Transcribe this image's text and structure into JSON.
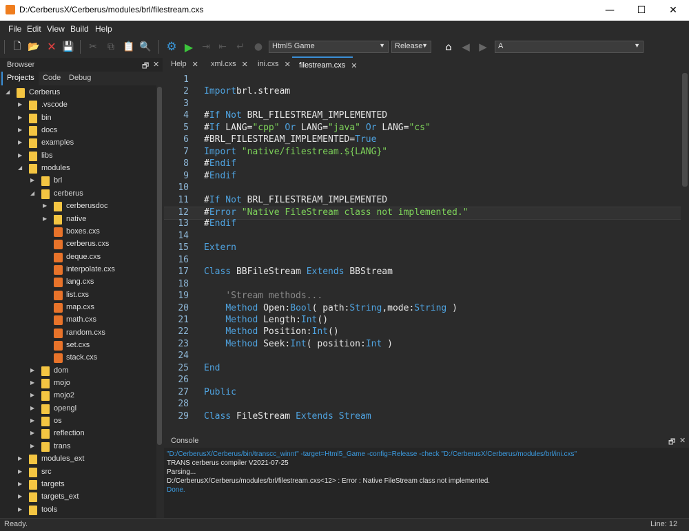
{
  "window": {
    "title": "D:/CerberusX/Cerberus/modules/brl/filestream.cxs",
    "min": "—",
    "max": "☐",
    "close": "✕"
  },
  "menu": [
    "File",
    "Edit",
    "View",
    "Build",
    "Help"
  ],
  "toolbar": {
    "target": "Html5 Game",
    "config": "Release",
    "search": "A"
  },
  "browser": {
    "title": "Browser",
    "pin": "🗗",
    "close": "✕",
    "tabs": [
      "Projects",
      "Code",
      "Debug"
    ]
  },
  "tree": [
    {
      "label": "Cerberus",
      "level": 0,
      "type": "folder",
      "expanded": true
    },
    {
      "label": ".vscode",
      "level": 1,
      "type": "folder",
      "expanded": false
    },
    {
      "label": "bin",
      "level": 1,
      "type": "folder",
      "expanded": false
    },
    {
      "label": "docs",
      "level": 1,
      "type": "folder",
      "expanded": false
    },
    {
      "label": "examples",
      "level": 1,
      "type": "folder",
      "expanded": false
    },
    {
      "label": "libs",
      "level": 1,
      "type": "folder",
      "expanded": false
    },
    {
      "label": "modules",
      "level": 1,
      "type": "folder",
      "expanded": true
    },
    {
      "label": "brl",
      "level": 2,
      "type": "folder",
      "expanded": false
    },
    {
      "label": "cerberus",
      "level": 2,
      "type": "folder",
      "expanded": true
    },
    {
      "label": "cerberusdoc",
      "level": 3,
      "type": "folder",
      "expanded": false
    },
    {
      "label": "native",
      "level": 3,
      "type": "folder",
      "expanded": false
    },
    {
      "label": "boxes.cxs",
      "level": 3,
      "type": "file"
    },
    {
      "label": "cerberus.cxs",
      "level": 3,
      "type": "file"
    },
    {
      "label": "deque.cxs",
      "level": 3,
      "type": "file"
    },
    {
      "label": "interpolate.cxs",
      "level": 3,
      "type": "file"
    },
    {
      "label": "lang.cxs",
      "level": 3,
      "type": "file"
    },
    {
      "label": "list.cxs",
      "level": 3,
      "type": "file"
    },
    {
      "label": "map.cxs",
      "level": 3,
      "type": "file"
    },
    {
      "label": "math.cxs",
      "level": 3,
      "type": "file"
    },
    {
      "label": "random.cxs",
      "level": 3,
      "type": "file"
    },
    {
      "label": "set.cxs",
      "level": 3,
      "type": "file"
    },
    {
      "label": "stack.cxs",
      "level": 3,
      "type": "file"
    },
    {
      "label": "dom",
      "level": 2,
      "type": "folder",
      "expanded": false
    },
    {
      "label": "mojo",
      "level": 2,
      "type": "folder",
      "expanded": false
    },
    {
      "label": "mojo2",
      "level": 2,
      "type": "folder",
      "expanded": false
    },
    {
      "label": "opengl",
      "level": 2,
      "type": "folder",
      "expanded": false
    },
    {
      "label": "os",
      "level": 2,
      "type": "folder",
      "expanded": false
    },
    {
      "label": "reflection",
      "level": 2,
      "type": "folder",
      "expanded": false
    },
    {
      "label": "trans",
      "level": 2,
      "type": "folder",
      "expanded": false
    },
    {
      "label": "modules_ext",
      "level": 1,
      "type": "folder",
      "expanded": false
    },
    {
      "label": "src",
      "level": 1,
      "type": "folder",
      "expanded": false
    },
    {
      "label": "targets",
      "level": 1,
      "type": "folder",
      "expanded": false
    },
    {
      "label": "targets_ext",
      "level": 1,
      "type": "folder",
      "expanded": false
    },
    {
      "label": "tools",
      "level": 1,
      "type": "folder",
      "expanded": false
    }
  ],
  "editor_tabs": [
    {
      "label": "Help",
      "active": false
    },
    {
      "label": "xml.cxs",
      "active": false
    },
    {
      "label": "ini.cxs",
      "active": false
    },
    {
      "label": "filestream.cxs",
      "active": true
    }
  ],
  "code": [
    {
      "n": "1",
      "t": []
    },
    {
      "n": "2",
      "t": [
        [
          "kw",
          "Import"
        ],
        [
          "",
          "brl.stream"
        ]
      ]
    },
    {
      "n": "3",
      "t": []
    },
    {
      "n": "4",
      "t": [
        [
          "",
          "#"
        ],
        [
          "kw",
          "If Not"
        ],
        [
          "",
          " BRL_FILESTREAM_IMPLEMENTED"
        ]
      ]
    },
    {
      "n": "5",
      "t": [
        [
          "",
          "#"
        ],
        [
          "kw",
          "If"
        ],
        [
          "",
          " LANG="
        ],
        [
          "st",
          "\"cpp\""
        ],
        [
          "",
          " "
        ],
        [
          "kw",
          "Or"
        ],
        [
          "",
          " LANG="
        ],
        [
          "st",
          "\"java\""
        ],
        [
          "",
          " "
        ],
        [
          "kw",
          "Or"
        ],
        [
          "",
          " LANG="
        ],
        [
          "st",
          "\"cs\""
        ]
      ]
    },
    {
      "n": "6",
      "t": [
        [
          "",
          "#BRL_FILESTREAM_IMPLEMENTED="
        ],
        [
          "kw",
          "True"
        ]
      ]
    },
    {
      "n": "7",
      "t": [
        [
          "kw",
          "Import"
        ],
        [
          "",
          " "
        ],
        [
          "st",
          "\"native/filestream.${LANG}\""
        ]
      ]
    },
    {
      "n": "8",
      "t": [
        [
          "",
          "#"
        ],
        [
          "kw",
          "Endif"
        ]
      ]
    },
    {
      "n": "9",
      "t": [
        [
          "",
          "#"
        ],
        [
          "kw",
          "Endif"
        ]
      ]
    },
    {
      "n": "10",
      "t": []
    },
    {
      "n": "11",
      "t": [
        [
          "",
          "#"
        ],
        [
          "kw",
          "If Not"
        ],
        [
          "",
          " BRL_FILESTREAM_IMPLEMENTED"
        ]
      ]
    },
    {
      "n": "12",
      "t": [
        [
          "",
          "#"
        ],
        [
          "kw",
          "Error"
        ],
        [
          "",
          " "
        ],
        [
          "st",
          "\"Native FileStream class not implemented.\""
        ]
      ],
      "hl": true
    },
    {
      "n": "13",
      "t": [
        [
          "",
          "#"
        ],
        [
          "kw",
          "Endif"
        ]
      ]
    },
    {
      "n": "14",
      "t": []
    },
    {
      "n": "15",
      "t": [
        [
          "kw",
          "Extern"
        ]
      ]
    },
    {
      "n": "16",
      "t": []
    },
    {
      "n": "17",
      "t": [
        [
          "kw",
          "Class"
        ],
        [
          "",
          " BBFileStream "
        ],
        [
          "kw",
          "Extends"
        ],
        [
          "",
          " BBStream"
        ]
      ]
    },
    {
      "n": "18",
      "t": []
    },
    {
      "n": "19",
      "t": [
        [
          "",
          "    "
        ],
        [
          "cm",
          "'Stream methods..."
        ]
      ]
    },
    {
      "n": "20",
      "t": [
        [
          "",
          "    "
        ],
        [
          "kw",
          "Method"
        ],
        [
          "",
          " Open:"
        ],
        [
          "kw",
          "Bool"
        ],
        [
          "",
          "( path:"
        ],
        [
          "kw",
          "String"
        ],
        [
          "",
          ",mode:"
        ],
        [
          "kw",
          "String"
        ],
        [
          "",
          " )"
        ]
      ]
    },
    {
      "n": "21",
      "t": [
        [
          "",
          "    "
        ],
        [
          "kw",
          "Method"
        ],
        [
          "",
          " Length:"
        ],
        [
          "kw",
          "Int"
        ],
        [
          "",
          "()"
        ]
      ]
    },
    {
      "n": "22",
      "t": [
        [
          "",
          "    "
        ],
        [
          "kw",
          "Method"
        ],
        [
          "",
          " Position:"
        ],
        [
          "kw",
          "Int"
        ],
        [
          "",
          "()"
        ]
      ]
    },
    {
      "n": "23",
      "t": [
        [
          "",
          "    "
        ],
        [
          "kw",
          "Method"
        ],
        [
          "",
          " Seek:"
        ],
        [
          "kw",
          "Int"
        ],
        [
          "",
          "( position:"
        ],
        [
          "kw",
          "Int"
        ],
        [
          "",
          " )"
        ]
      ]
    },
    {
      "n": "24",
      "t": []
    },
    {
      "n": "25",
      "t": [
        [
          "kw",
          "End"
        ]
      ]
    },
    {
      "n": "26",
      "t": []
    },
    {
      "n": "27",
      "t": [
        [
          "kw",
          "Public"
        ]
      ]
    },
    {
      "n": "28",
      "t": []
    },
    {
      "n": "29",
      "t": [
        [
          "kw",
          "Class"
        ],
        [
          "",
          " FileStream "
        ],
        [
          "kw",
          "Extends"
        ],
        [
          "",
          " "
        ],
        [
          "kw",
          "Stream"
        ]
      ]
    }
  ],
  "console": {
    "title": "Console",
    "lines": [
      {
        "text": "\"D:/CerberusX/Cerberus/bin/transcc_winnt\" -target=Html5_Game -config=Release -check \"D:/CerberusX/Cerberus/modules/brl/ini.cxs\"",
        "color": "#3b9be0"
      },
      {
        "text": "TRANS cerberus compiler V2021-07-25",
        "color": "#e6e6e6"
      },
      {
        "text": "Parsing...",
        "color": "#e6e6e6"
      },
      {
        "text": "D:/CerberusX/Cerberus/modules/brl/filestream.cxs<12> : Error : Native FileStream class not implemented.",
        "color": "#e6e6e6"
      },
      {
        "text": "Done.",
        "color": "#3b9be0"
      }
    ]
  },
  "status": {
    "left": "Ready.",
    "right": "Line: 12"
  }
}
